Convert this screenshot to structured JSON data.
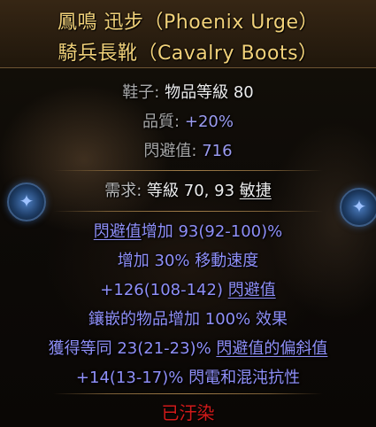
{
  "item": {
    "name": "鳳鳴 迅步（Phoenix Urge）",
    "base_type": "騎兵長靴（Cavalry Boots）"
  },
  "properties": {
    "category_label": "鞋子:",
    "item_level_label": "物品等級",
    "item_level_value": "80",
    "quality_label": "品質:",
    "quality_value": "+20%",
    "evasion_label": "閃避值:",
    "evasion_value": "716"
  },
  "requirements": {
    "label": "需求:",
    "level_label": "等級",
    "level_value": "70, 93",
    "stat": "敏捷"
  },
  "mods": [
    {
      "pre": "",
      "hl": "閃避值",
      "post": "增加 93(92-100)%"
    },
    {
      "pre": "增加 30% 移動速度",
      "hl": "",
      "post": ""
    },
    {
      "pre": "+126(108-142) ",
      "hl": "閃避值",
      "post": ""
    },
    {
      "pre": "鑲嵌的物品增加 100% 效果",
      "hl": "",
      "post": ""
    },
    {
      "pre": "獲得等同 23(21-23)% ",
      "hl": "閃避值的偏斜值",
      "post": ""
    },
    {
      "pre": "+14(13-17)% 閃電和混沌抗性",
      "hl": "",
      "post": ""
    }
  ],
  "status": {
    "corrupted": "已汙染"
  },
  "colors": {
    "unique_name": "#f2d27a",
    "magic_mod": "#8f8ff8",
    "corrupted": "#d01a1a"
  },
  "icons": [
    "socket-orb-icon"
  ]
}
